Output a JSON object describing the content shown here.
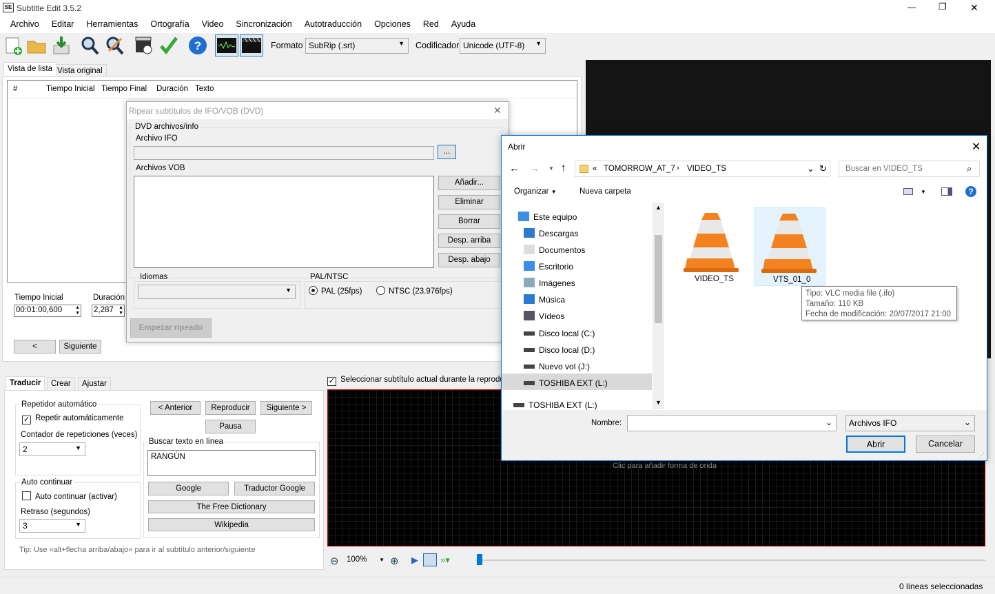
{
  "app": {
    "title": "Subtitle Edit 3.5.2",
    "window_controls": {
      "minimize": "—",
      "maximize": "❐",
      "close": "✕"
    },
    "menu": [
      "Archivo",
      "Editar",
      "Herramientas",
      "Ortografía",
      "Video",
      "Sincronización",
      "Autotraducción",
      "Opciones",
      "Red",
      "Ayuda"
    ],
    "toolbar": {
      "format_label": "Formato",
      "format_value": "SubRip (.srt)",
      "encoding_label": "Codificador",
      "encoding_value": "Unicode (UTF-8)"
    },
    "tabs": [
      "Vista de lista",
      "Vista original"
    ],
    "columns": [
      "#",
      "Tiempo Inicial",
      "Tiempo Final",
      "Duración",
      "Texto"
    ],
    "edit": {
      "start_label": "Tiempo Inicial",
      "start_value": "00:01:00,600",
      "duration_label": "Duración",
      "duration_value": "2,287",
      "prev_button": "<",
      "next_button": "Siguiente"
    },
    "bottom_tabs": [
      "Traducir",
      "Crear",
      "Ajustar"
    ],
    "translate": {
      "auto_repeat_group": "Repetidor automático",
      "auto_repeat_check": "Repetir automáticamente",
      "repeat_count_label": "Contador de repeticiones (veces)",
      "repeat_count_value": "2",
      "auto_continue_group": "Auto continuar",
      "auto_continue_check": "Auto continuar (activar)",
      "delay_label": "Retraso (segundos)",
      "delay_value": "3",
      "btn_prev": "< Anterior",
      "btn_play": "Reproducir",
      "btn_next": "Siguiente >",
      "btn_pause": "Pausa",
      "search_group": "Buscar texto en línea",
      "search_text": "RANGÚN",
      "btn_google": "Google",
      "btn_google_translate": "Traductor Google",
      "btn_free_dictionary": "The Free Dictionary",
      "btn_wikipedia": "Wikipedia",
      "tip": "Tip: Use «alt+flecha arriba/abajo» para ir al subtítulo anterior/siguiente"
    },
    "select_current_check": "Seleccionar subtítulo actual durante la reproducción",
    "waveform_hint": "Clic para añadir forma de onda",
    "zoom_value": "100%",
    "status_text": "0 líneas seleccionadas"
  },
  "rip_dialog": {
    "title": "Ripear subtítulos de IFO/VOB (DVD)",
    "group_title": "DVD archivos/info",
    "ifo_label": "Archivo IFO",
    "browse_button": "...",
    "vob_label": "Archivos VOB",
    "btn_add": "Añadir...",
    "btn_remove": "Eliminar",
    "btn_clear": "Borrar",
    "btn_move_up": "Desp. arriba",
    "btn_move_down": "Desp. abajo",
    "languages_label": "Idiomas",
    "palntsc_label": "PAL/NTSC",
    "pal_option": "PAL (25fps)",
    "ntsc_option": "NTSC (23.976fps)",
    "start_button": "Empezar ripeado"
  },
  "open_dialog": {
    "title": "Abrir",
    "path": [
      "TOMORROW_AT_7",
      "VIDEO_TS"
    ],
    "path_prefix": "«",
    "search_placeholder": "Buscar en VIDEO_TS",
    "organize": "Organizar",
    "new_folder": "Nueva carpeta",
    "tree": [
      {
        "label": "Este equipo",
        "icon": "computer-icon"
      },
      {
        "label": "Descargas",
        "icon": "download-icon"
      },
      {
        "label": "Documentos",
        "icon": "document-icon"
      },
      {
        "label": "Escritorio",
        "icon": "desktop-icon"
      },
      {
        "label": "Imágenes",
        "icon": "pictures-icon"
      },
      {
        "label": "Música",
        "icon": "music-icon"
      },
      {
        "label": "Vídeos",
        "icon": "video-icon"
      },
      {
        "label": "Disco local (C:)",
        "icon": "drive-icon"
      },
      {
        "label": "Disco local (D:)",
        "icon": "drive-icon"
      },
      {
        "label": "Nuevo vol (J:)",
        "icon": "drive-icon"
      },
      {
        "label": "TOSHIBA EXT (L:)",
        "icon": "drive-icon"
      },
      {
        "label": "TOSHIBA EXT (L:)",
        "icon": "drive-icon"
      }
    ],
    "files": [
      {
        "name": "VIDEO_TS",
        "icon": "vlc-cone-icon"
      },
      {
        "name": "VTS_01_0",
        "icon": "vlc-cone-icon"
      }
    ],
    "tooltip": {
      "type": "Tipo: VLC media file (.ifo)",
      "size": "Tamaño: 110 KB",
      "modified": "Fecha de modificación: 20/07/2017 21:00"
    },
    "name_label": "Nombre:",
    "name_value": "",
    "filter_value": "Archivos IFO",
    "btn_open": "Abrir",
    "btn_cancel": "Cancelar"
  },
  "colors": {
    "accent": "#0078d7",
    "video_bg": "#141414",
    "waveform_bg": "#000000",
    "waveform_border": "#c00000",
    "vlc_orange": "#f58220",
    "selection": "#cce8ff"
  }
}
